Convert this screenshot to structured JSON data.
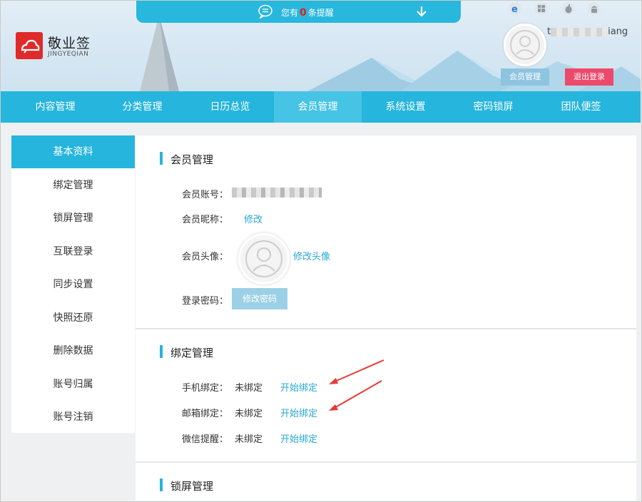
{
  "header": {
    "logo_title": "敬业签",
    "logo_sub": "JINGYEQIAN",
    "notice": {
      "prefix": "您有",
      "count": "0",
      "suffix": "条提醒"
    },
    "platforms": [
      "ie-icon",
      "windows-icon",
      "apple-icon",
      "android-icon"
    ],
    "user_name_start": "t",
    "user_name_end": "iang",
    "member_button": "会员管理",
    "logout_button": "退出登录"
  },
  "nav": {
    "items": [
      "内容管理",
      "分类管理",
      "日历总览",
      "会员管理",
      "系统设置",
      "密码锁屏",
      "团队便签"
    ],
    "active": "会员管理"
  },
  "sidebar": {
    "items": [
      "基本资料",
      "绑定管理",
      "锁屏管理",
      "互联登录",
      "同步设置",
      "快照还原",
      "删除数据",
      "账号归属",
      "账号注销"
    ],
    "active": "基本资料"
  },
  "member": {
    "title": "会员管理",
    "account_label": "会员账号：",
    "nickname_label": "会员昵称：",
    "nickname_link": "修改",
    "avatar_label": "会员头像：",
    "avatar_link": "修改头像",
    "password_label": "登录密码：",
    "password_button": "修改密码"
  },
  "binding": {
    "title": "绑定管理",
    "rows": [
      {
        "label": "手机绑定：",
        "status": "未绑定",
        "action": "开始绑定"
      },
      {
        "label": "邮箱绑定：",
        "status": "未绑定",
        "action": "开始绑定"
      },
      {
        "label": "微信提醒：",
        "status": "未绑定",
        "action": "开始绑定"
      }
    ]
  },
  "lockscreen": {
    "title": "锁屏管理"
  },
  "colors": {
    "accent": "#26b5dc",
    "logo": "#e02a2a",
    "logout": "#ec4a6a",
    "link": "#26a8d3",
    "annotation": "#e53b35"
  }
}
